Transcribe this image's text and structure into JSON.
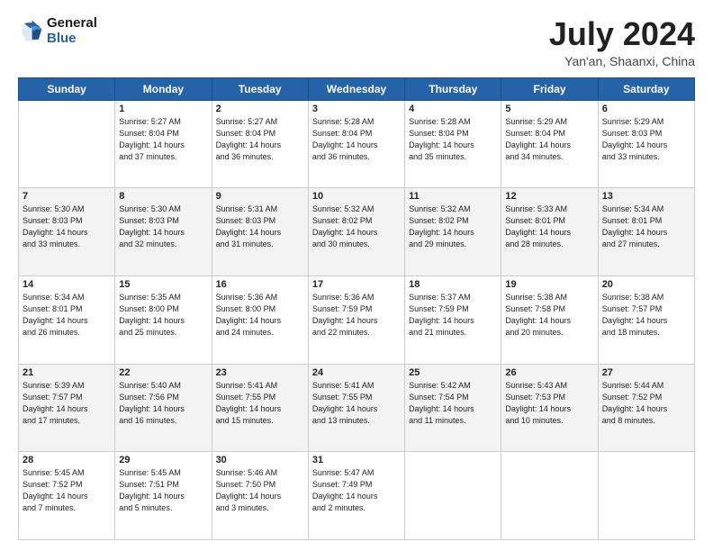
{
  "header": {
    "logo_general": "General",
    "logo_blue": "Blue",
    "month_year": "July 2024",
    "location": "Yan'an, Shaanxi, China"
  },
  "weekdays": [
    "Sunday",
    "Monday",
    "Tuesday",
    "Wednesday",
    "Thursday",
    "Friday",
    "Saturday"
  ],
  "weeks": [
    [
      {
        "day": "",
        "info": ""
      },
      {
        "day": "1",
        "info": "Sunrise: 5:27 AM\nSunset: 8:04 PM\nDaylight: 14 hours\nand 37 minutes."
      },
      {
        "day": "2",
        "info": "Sunrise: 5:27 AM\nSunset: 8:04 PM\nDaylight: 14 hours\nand 36 minutes."
      },
      {
        "day": "3",
        "info": "Sunrise: 5:28 AM\nSunset: 8:04 PM\nDaylight: 14 hours\nand 36 minutes."
      },
      {
        "day": "4",
        "info": "Sunrise: 5:28 AM\nSunset: 8:04 PM\nDaylight: 14 hours\nand 35 minutes."
      },
      {
        "day": "5",
        "info": "Sunrise: 5:29 AM\nSunset: 8:04 PM\nDaylight: 14 hours\nand 34 minutes."
      },
      {
        "day": "6",
        "info": "Sunrise: 5:29 AM\nSunset: 8:03 PM\nDaylight: 14 hours\nand 33 minutes."
      }
    ],
    [
      {
        "day": "7",
        "info": "Sunrise: 5:30 AM\nSunset: 8:03 PM\nDaylight: 14 hours\nand 33 minutes."
      },
      {
        "day": "8",
        "info": "Sunrise: 5:30 AM\nSunset: 8:03 PM\nDaylight: 14 hours\nand 32 minutes."
      },
      {
        "day": "9",
        "info": "Sunrise: 5:31 AM\nSunset: 8:03 PM\nDaylight: 14 hours\nand 31 minutes."
      },
      {
        "day": "10",
        "info": "Sunrise: 5:32 AM\nSunset: 8:02 PM\nDaylight: 14 hours\nand 30 minutes."
      },
      {
        "day": "11",
        "info": "Sunrise: 5:32 AM\nSunset: 8:02 PM\nDaylight: 14 hours\nand 29 minutes."
      },
      {
        "day": "12",
        "info": "Sunrise: 5:33 AM\nSunset: 8:01 PM\nDaylight: 14 hours\nand 28 minutes."
      },
      {
        "day": "13",
        "info": "Sunrise: 5:34 AM\nSunset: 8:01 PM\nDaylight: 14 hours\nand 27 minutes."
      }
    ],
    [
      {
        "day": "14",
        "info": "Sunrise: 5:34 AM\nSunset: 8:01 PM\nDaylight: 14 hours\nand 26 minutes."
      },
      {
        "day": "15",
        "info": "Sunrise: 5:35 AM\nSunset: 8:00 PM\nDaylight: 14 hours\nand 25 minutes."
      },
      {
        "day": "16",
        "info": "Sunrise: 5:36 AM\nSunset: 8:00 PM\nDaylight: 14 hours\nand 24 minutes."
      },
      {
        "day": "17",
        "info": "Sunrise: 5:36 AM\nSunset: 7:59 PM\nDaylight: 14 hours\nand 22 minutes."
      },
      {
        "day": "18",
        "info": "Sunrise: 5:37 AM\nSunset: 7:59 PM\nDaylight: 14 hours\nand 21 minutes."
      },
      {
        "day": "19",
        "info": "Sunrise: 5:38 AM\nSunset: 7:58 PM\nDaylight: 14 hours\nand 20 minutes."
      },
      {
        "day": "20",
        "info": "Sunrise: 5:38 AM\nSunset: 7:57 PM\nDaylight: 14 hours\nand 18 minutes."
      }
    ],
    [
      {
        "day": "21",
        "info": "Sunrise: 5:39 AM\nSunset: 7:57 PM\nDaylight: 14 hours\nand 17 minutes."
      },
      {
        "day": "22",
        "info": "Sunrise: 5:40 AM\nSunset: 7:56 PM\nDaylight: 14 hours\nand 16 minutes."
      },
      {
        "day": "23",
        "info": "Sunrise: 5:41 AM\nSunset: 7:55 PM\nDaylight: 14 hours\nand 15 minutes."
      },
      {
        "day": "24",
        "info": "Sunrise: 5:41 AM\nSunset: 7:55 PM\nDaylight: 14 hours\nand 13 minutes."
      },
      {
        "day": "25",
        "info": "Sunrise: 5:42 AM\nSunset: 7:54 PM\nDaylight: 14 hours\nand 11 minutes."
      },
      {
        "day": "26",
        "info": "Sunrise: 5:43 AM\nSunset: 7:53 PM\nDaylight: 14 hours\nand 10 minutes."
      },
      {
        "day": "27",
        "info": "Sunrise: 5:44 AM\nSunset: 7:52 PM\nDaylight: 14 hours\nand 8 minutes."
      }
    ],
    [
      {
        "day": "28",
        "info": "Sunrise: 5:45 AM\nSunset: 7:52 PM\nDaylight: 14 hours\nand 7 minutes."
      },
      {
        "day": "29",
        "info": "Sunrise: 5:45 AM\nSunset: 7:51 PM\nDaylight: 14 hours\nand 5 minutes."
      },
      {
        "day": "30",
        "info": "Sunrise: 5:46 AM\nSunset: 7:50 PM\nDaylight: 14 hours\nand 3 minutes."
      },
      {
        "day": "31",
        "info": "Sunrise: 5:47 AM\nSunset: 7:49 PM\nDaylight: 14 hours\nand 2 minutes."
      },
      {
        "day": "",
        "info": ""
      },
      {
        "day": "",
        "info": ""
      },
      {
        "day": "",
        "info": ""
      }
    ]
  ]
}
